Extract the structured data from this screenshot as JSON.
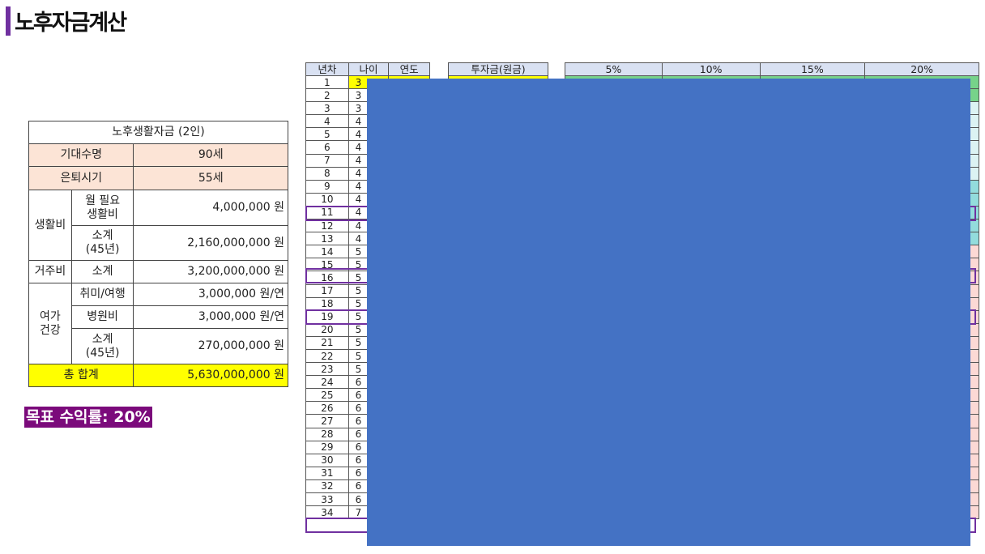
{
  "title": "노후자금계산",
  "fund": {
    "header": "노후생활자금 (2인)",
    "life_label": "기대수명",
    "life_value": "90세",
    "retire_label": "은퇴시기",
    "retire_value": "55세",
    "living_label": "생활비",
    "monthly_label": "월 필요\n생활비",
    "monthly_value": "4,000,000 원",
    "living_sub_label": "소계\n(45년)",
    "living_sub_value": "2,160,000,000 원",
    "housing_label": "거주비",
    "housing_sub_label": "소계",
    "housing_sub_value": "3,200,000,000 원",
    "leisure_label": "여가\n건강",
    "hobby_label": "취미/여행",
    "hobby_value": "3,000,000 원/연",
    "hospital_label": "병원비",
    "hospital_value": "3,000,000 원/연",
    "leisure_sub_label": "소계\n(45년)",
    "leisure_sub_value": "270,000,000 원",
    "total_label": "총 합계",
    "total_value": "5,630,000,000 원"
  },
  "goal": "목표 수익률: 20%",
  "years_table": {
    "headers": [
      "년차",
      "나이",
      "연도"
    ],
    "years": [
      "1",
      "2",
      "3",
      "4",
      "5",
      "6",
      "7",
      "8",
      "9",
      "10",
      "11",
      "12",
      "13",
      "14",
      "15",
      "16",
      "17",
      "18",
      "19",
      "20",
      "21",
      "22",
      "23",
      "24",
      "25",
      "26",
      "27",
      "28",
      "29",
      "30",
      "31",
      "32",
      "33",
      "34"
    ],
    "age_partial": [
      "3",
      "3",
      "3",
      "4",
      "4",
      "4",
      "4",
      "4",
      "4",
      "4",
      "4",
      "4",
      "4",
      "5",
      "5",
      "5",
      "5",
      "5",
      "5",
      "5",
      "5",
      "5",
      "5",
      "6",
      "6",
      "6",
      "6",
      "6",
      "6",
      "6",
      "6",
      "6",
      "6",
      "7"
    ]
  },
  "invest_header": "투자금(원금)",
  "rate_headers": [
    "5%",
    "10%",
    "15%",
    "20%"
  ],
  "colors": {
    "green": "#77d38a",
    "lightcyan": "#dcf3f3",
    "teal": "#93dcdc",
    "pink": "#fcd9d5",
    "accent": "#7030a0"
  }
}
